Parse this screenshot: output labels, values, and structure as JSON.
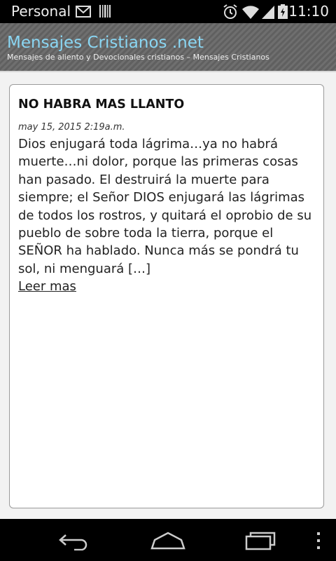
{
  "status_bar": {
    "carrier": "Personal",
    "time": "11:10",
    "icons": [
      "email-icon",
      "barcode-icon",
      "alarm-icon",
      "wifi-icon",
      "signal-icon",
      "battery-icon"
    ]
  },
  "header": {
    "site_title": "Mensajes Cristianos .net",
    "tagline": "Mensajes de aliento y Devocionales cristianos – Mensajes Cristianos",
    "title_color": "#8ad6f3"
  },
  "post": {
    "title": "NO HABRA MAS LLANTO",
    "date": "may 15, 2015 2:19a.m.",
    "excerpt": "Dios enjugará toda lágrima…ya no habrá muerte…ni dolor, porque las primeras cosas han pasado. El destruirá la muerte para siempre; el Señor DIOS enjugará las lágrimas de todos los rostros, y quitará el oprobio de su pueblo de sobre toda la tierra, porque el SEÑOR ha hablado. Nunca más se pondrá tu sol, ni menguará […]",
    "read_more": "Leer mas"
  },
  "nav_bar": {
    "buttons": [
      "back-icon",
      "home-icon",
      "recents-icon",
      "menu-icon"
    ]
  }
}
